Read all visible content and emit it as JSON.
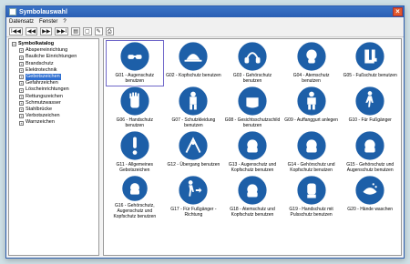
{
  "window": {
    "title": "Symbolauswahl",
    "close_label": "×"
  },
  "menu": [
    "Datensatz",
    "Fenster",
    "?"
  ],
  "toolbar": [
    "I◀◀",
    "◀◀",
    "▶▶",
    "▶▶I",
    "▤",
    "▢",
    "✎",
    "⎙"
  ],
  "sidebar": {
    "root": "Symbolkatalog",
    "items": [
      "Absperreinrichtung",
      "Bauliche Einrichtungen",
      "Brandschutz",
      "Elektrotechnik",
      "Gebotszeichen",
      "Gefahrzeichen",
      "Löscheinrichtungen",
      "Rettungszeichen",
      "Schmutzwasser",
      "Stahlbrücke",
      "Verbotszeichen",
      "Warnzeichen"
    ],
    "selected_index": 4
  },
  "tiles": [
    {
      "label": "G01 - Augenschutz benutzen",
      "icon": "goggles-icon"
    },
    {
      "label": "G02 - Kopfschutz benutzen",
      "icon": "helmet-icon"
    },
    {
      "label": "G03 - Gehörschutz benutzen",
      "icon": "ear-protection-icon"
    },
    {
      "label": "G04 - Atemschutz benutzen",
      "icon": "respirator-icon"
    },
    {
      "label": "G05 - Fußschutz benutzen",
      "icon": "boots-icon"
    },
    {
      "label": "G06 - Handschutz benutzen",
      "icon": "glove-icon"
    },
    {
      "label": "G07 - Schutzkleidung benutzen",
      "icon": "overall-icon"
    },
    {
      "label": "G08 - Gesichtsschutzschild benutzen",
      "icon": "face-shield-icon"
    },
    {
      "label": "G09 - Auffanggurt anlegen",
      "icon": "harness-icon"
    },
    {
      "label": "G10 - Für Fußgänger",
      "icon": "pedestrian-icon"
    },
    {
      "label": "G11 - Allgemeines Gebotszeichen",
      "icon": "exclamation-icon"
    },
    {
      "label": "G12 - Übergang benutzen",
      "icon": "crossing-icon"
    },
    {
      "label": "G13 - Augenschutz und Kopfschutz benutzen",
      "icon": "goggles-helmet-icon"
    },
    {
      "label": "G14 - Gehörschutz und Kopfschutz benutzen",
      "icon": "ear-helmet-icon"
    },
    {
      "label": "G15 - Gehörschutz und Augenschutz benutzen",
      "icon": "ear-goggles-icon"
    },
    {
      "label": "G16 - Gehörschutz, Augenschutz und Kopfschutz benutzen",
      "icon": "full-head-icon"
    },
    {
      "label": "G17 - Für Fußgänger - Richtung",
      "icon": "pedestrian-direction-icon"
    },
    {
      "label": "G18 - Atemschutz und Kopfschutz benutzen",
      "icon": "respirator-helmet-icon"
    },
    {
      "label": "G19 - Handschutz mit Pulsschutz benutzen",
      "icon": "glove-wrist-icon"
    },
    {
      "label": "G20 - Hände waschen",
      "icon": "hand-wash-icon"
    }
  ],
  "selected_tile_index": 0,
  "colors": {
    "sign_blue": "#1d5fa8",
    "selection": "#2f6fd1"
  }
}
